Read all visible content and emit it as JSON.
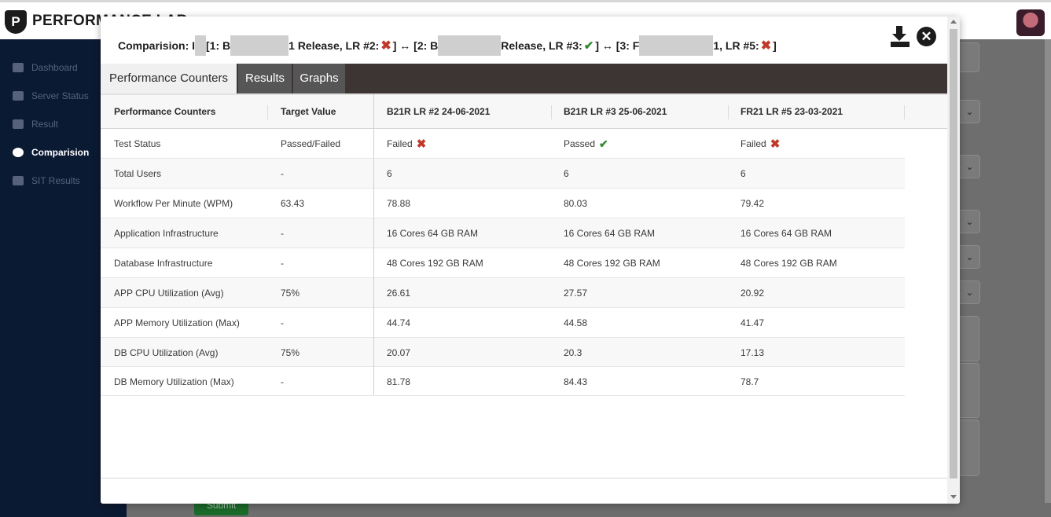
{
  "app": {
    "logo_letter": "P",
    "name": "PERFORMANCE LAB",
    "sidebar": {
      "items": [
        {
          "label": "Dashboard",
          "icon": "bar-chart-icon",
          "active": false
        },
        {
          "label": "Server Status",
          "icon": "power-icon",
          "active": false
        },
        {
          "label": "Result",
          "icon": "list-icon",
          "active": false
        },
        {
          "label": "Comparision",
          "icon": "gears-icon",
          "active": true
        },
        {
          "label": "SIT Results",
          "icon": "sitemap-icon",
          "active": false
        }
      ]
    },
    "submit_label": "Submit"
  },
  "modal": {
    "title": {
      "prefix": "Comparision: I",
      "part1_open": "[1: B",
      "part1_close": "1 Release, LR #2:",
      "part2_open": "] ↔ [2: B",
      "part2_close": "Release, LR #3:",
      "part3_open": "] ↔ [3: F",
      "part3_close": "1, LR #5:",
      "suffix": "]",
      "status1": "fail",
      "status2": "pass",
      "status3": "fail"
    },
    "icons": {
      "download": "download-icon",
      "close": "close-circle-icon",
      "fail": "cross-icon",
      "pass": "check-icon"
    },
    "colors": {
      "fail": "#c0392b",
      "pass": "#2f8a2f",
      "tabbar": "#3d3533"
    },
    "tabs": [
      {
        "label": "Performance Counters",
        "active": true
      },
      {
        "label": "Results",
        "active": false
      },
      {
        "label": "Graphs",
        "active": false
      }
    ],
    "table": {
      "headers": [
        "Performance Counters",
        "Target Value",
        "B21R LR #2 24-06-2021",
        "B21R LR #3 25-06-2021",
        "FR21 LR #5 23-03-2021"
      ],
      "rows": [
        {
          "counter": "Test Status",
          "target": "Passed/Failed",
          "v1": "Failed",
          "v2": "Passed",
          "v3": "Failed"
        },
        {
          "counter": "Total Users",
          "target": "-",
          "v1": "6",
          "v2": "6",
          "v3": "6"
        },
        {
          "counter": "Workflow Per Minute (WPM)",
          "target": "63.43",
          "v1": "78.88",
          "v2": "80.03",
          "v3": "79.42"
        },
        {
          "counter": "Application Infrastructure",
          "target": "-",
          "v1": "16 Cores 64 GB RAM",
          "v2": "16 Cores 64 GB RAM",
          "v3": "16 Cores 64 GB RAM"
        },
        {
          "counter": "Database Infrastructure",
          "target": "-",
          "v1": "48 Cores 192 GB RAM",
          "v2": "48 Cores 192 GB RAM",
          "v3": "48 Cores 192 GB RAM"
        },
        {
          "counter": "APP CPU Utilization (Avg)",
          "target": "75%",
          "v1": "26.61",
          "v2": "27.57",
          "v3": "20.92"
        },
        {
          "counter": "APP Memory Utilization (Max)",
          "target": "-",
          "v1": "44.74",
          "v2": "44.58",
          "v3": "41.47"
        },
        {
          "counter": "DB CPU Utilization (Avg)",
          "target": "75%",
          "v1": "20.07",
          "v2": "20.3",
          "v3": "17.13"
        },
        {
          "counter": "DB Memory Utilization (Max)",
          "target": "-",
          "v1": "81.78",
          "v2": "84.43",
          "v3": "78.7"
        }
      ]
    }
  }
}
